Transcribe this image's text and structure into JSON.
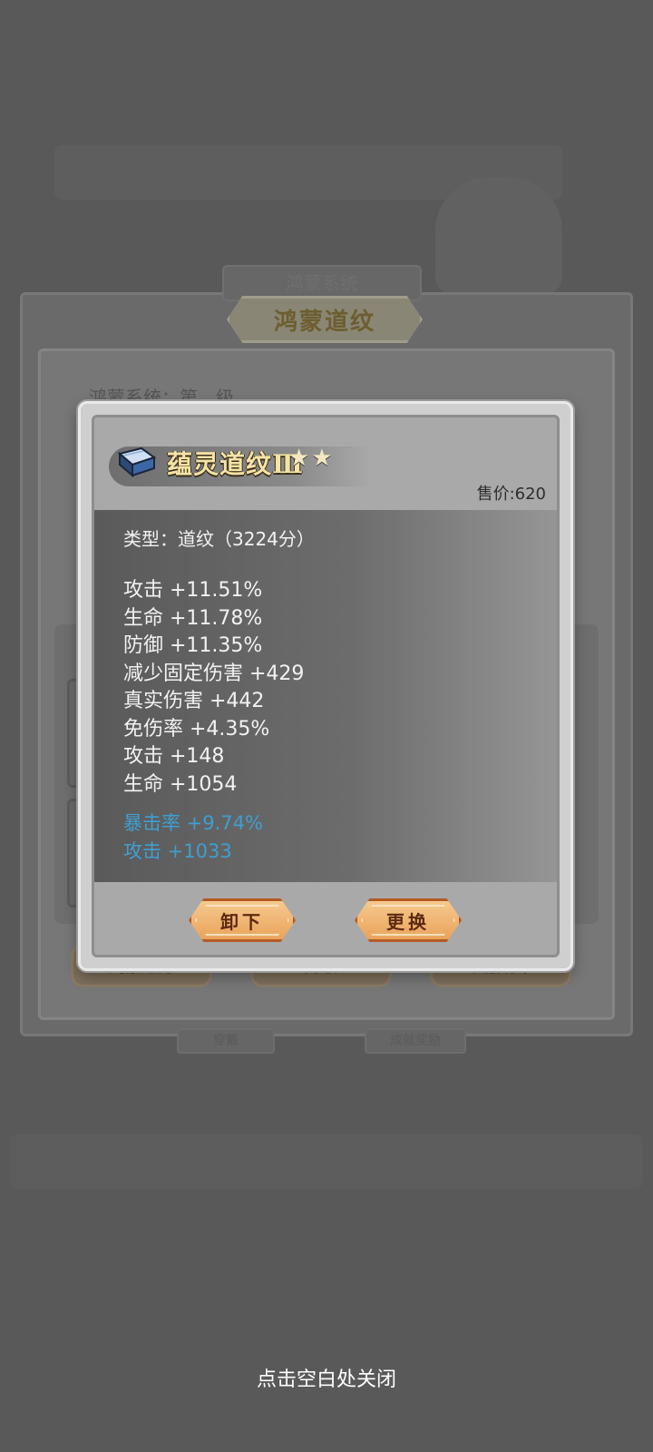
{
  "background": {
    "header_title": "鸿蒙道纹",
    "tab_faded": "鸿蒙系统",
    "subtitle": "鸿蒙系统：第…级",
    "buttons": [
      "鸿蒙之力",
      "升级",
      "纹晶坊市"
    ],
    "lower_tabs": [
      "穿戴",
      "成就奖励"
    ]
  },
  "item": {
    "name": "蕴灵道纹Ⅲ",
    "stars": "★★",
    "sell_price": "售价:620",
    "type_line": "类型：道纹（3224分）",
    "stats": [
      "攻击 +11.51%",
      "生命 +11.78%",
      "防御 +11.35%",
      "减少固定伤害 +429",
      "真实伤害 +442",
      "免伤率 +4.35%",
      "攻击 +148",
      "生命 +1054"
    ],
    "extra_stats": [
      "暴击率 +9.74%",
      "攻击 +1033"
    ]
  },
  "actions": {
    "unequip": "卸下",
    "replace": "更换"
  },
  "close_hint": "点击空白处关闭",
  "colors": {
    "title_text": "#f5e3a6",
    "extra_stat": "#3f9fd0",
    "button_fill": "#eaa35b",
    "button_border": "#b45a24"
  }
}
